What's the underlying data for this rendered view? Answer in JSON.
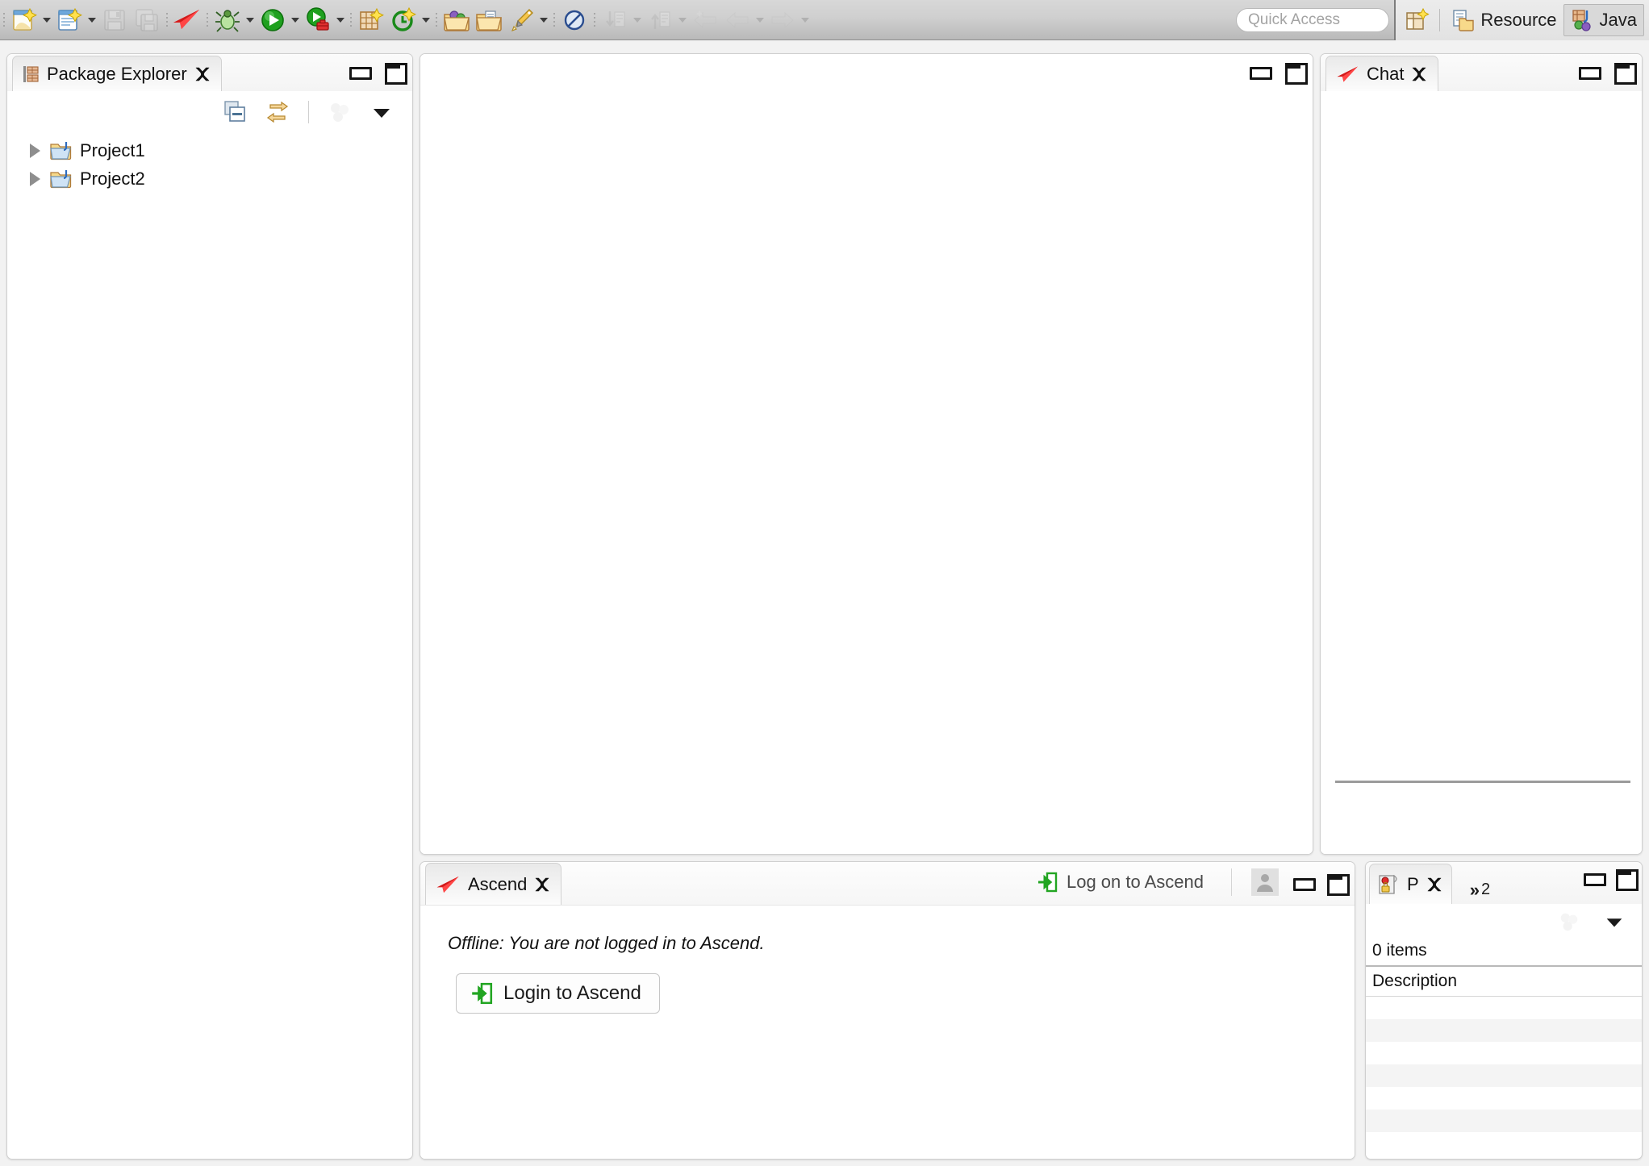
{
  "toolbar": {
    "groups": [
      {
        "name": "new-group",
        "buttons": [
          {
            "name": "new-wizard-button",
            "icon": "new-file-icon",
            "dropdown": true,
            "enabled": true
          },
          {
            "name": "new-java-class-button",
            "icon": "new-class-icon",
            "dropdown": true,
            "enabled": true
          },
          {
            "name": "save-button",
            "icon": "save-icon",
            "dropdown": false,
            "enabled": false
          },
          {
            "name": "save-all-button",
            "icon": "save-all-icon",
            "dropdown": false,
            "enabled": false
          }
        ]
      },
      {
        "name": "ascend-group",
        "buttons": [
          {
            "name": "ascend-button",
            "icon": "ascend-paper-plane-icon",
            "dropdown": false,
            "enabled": true
          }
        ]
      },
      {
        "name": "run-group",
        "buttons": [
          {
            "name": "debug-button",
            "icon": "debug-bug-icon",
            "dropdown": true,
            "enabled": true
          },
          {
            "name": "run-button",
            "icon": "run-play-icon",
            "dropdown": true,
            "enabled": true
          },
          {
            "name": "run-external-tools-button",
            "icon": "external-tools-icon",
            "dropdown": true,
            "enabled": true
          }
        ]
      },
      {
        "name": "java-group",
        "buttons": [
          {
            "name": "new-java-project-button",
            "icon": "new-java-project-icon",
            "dropdown": false,
            "enabled": true
          },
          {
            "name": "new-annotation-button",
            "icon": "new-annotation-icon",
            "dropdown": true,
            "enabled": true
          }
        ]
      },
      {
        "name": "open-group",
        "buttons": [
          {
            "name": "open-type-button",
            "icon": "open-type-icon",
            "dropdown": false,
            "enabled": true
          },
          {
            "name": "open-task-button",
            "icon": "open-task-icon",
            "dropdown": false,
            "enabled": true
          },
          {
            "name": "search-button",
            "icon": "pencil-search-icon",
            "dropdown": true,
            "enabled": true
          }
        ]
      },
      {
        "name": "marker-group",
        "buttons": [
          {
            "name": "skip-breakpoints-button",
            "icon": "skip-breakpoints-icon",
            "dropdown": false,
            "enabled": true
          }
        ]
      },
      {
        "name": "navigate-group",
        "buttons": [
          {
            "name": "next-annotation-button",
            "icon": "next-annotation-icon",
            "dropdown": true,
            "enabled": false
          },
          {
            "name": "previous-annotation-button",
            "icon": "previous-annotation-icon",
            "dropdown": true,
            "enabled": false
          },
          {
            "name": "last-edit-location-button",
            "icon": "last-edit-location-icon",
            "dropdown": false,
            "enabled": false
          },
          {
            "name": "back-button",
            "icon": "back-arrow-icon",
            "dropdown": true,
            "enabled": false
          },
          {
            "name": "forward-button",
            "icon": "forward-arrow-icon",
            "dropdown": true,
            "enabled": false
          }
        ]
      }
    ],
    "quick_access_placeholder": "Quick Access",
    "open_perspective_label": "",
    "perspectives": [
      {
        "name": "perspective-resource",
        "label": "Resource",
        "active": false
      },
      {
        "name": "perspective-java",
        "label": "Java",
        "active": true
      }
    ]
  },
  "package_explorer": {
    "tab_label": "Package Explorer",
    "toolbar": [
      {
        "name": "collapse-all-button",
        "icon": "collapse-all-icon",
        "enabled": true
      },
      {
        "name": "link-with-editor-button",
        "icon": "link-with-editor-icon",
        "enabled": true
      },
      {
        "name": "view-menu-filters-button",
        "icon": "filters-icon",
        "enabled": false
      },
      {
        "name": "view-menu-button",
        "icon": "view-menu-chevron-icon",
        "enabled": true
      }
    ],
    "tree": [
      {
        "label": "Project1",
        "expanded": false,
        "icon": "java-project-icon"
      },
      {
        "label": "Project2",
        "expanded": false,
        "icon": "java-project-icon"
      }
    ]
  },
  "editor": {
    "content": ""
  },
  "chat": {
    "tab_label": "Chat",
    "icon": "ascend-paper-plane-icon",
    "messages": [],
    "input_value": ""
  },
  "ascend": {
    "tab_label": "Ascend",
    "icon": "ascend-paper-plane-icon",
    "logon_link_label": "Log on to Ascend",
    "offline_message": "Offline: You are not logged in to Ascend.",
    "login_button_label": "Login to Ascend",
    "tools": [
      {
        "name": "user-account-button",
        "icon": "user-avatar-icon"
      }
    ]
  },
  "problems": {
    "tab_label": "P",
    "overflow_label": "2",
    "overflow_chevron": "»",
    "item_count_label": "0 items",
    "columns": [
      "Description"
    ],
    "rows": [],
    "placeholder_rows": 7,
    "toolbar": [
      {
        "name": "problems-filters-button",
        "icon": "filters-icon",
        "enabled": false
      },
      {
        "name": "problems-view-menu-button",
        "icon": "view-menu-chevron-icon",
        "enabled": true
      }
    ]
  },
  "window_controls": {
    "minimize_label": "Minimize",
    "maximize_label": "Maximize",
    "close_label": "Close"
  },
  "colors": {
    "toolbar_bg": "#cfcfcf",
    "panel_bg": "#ffffff",
    "accent_red": "#ee2a2a",
    "accent_green": "#2aa52a",
    "text": "#111111",
    "muted_text": "#a3a3a3",
    "divider": "#9b9b9b",
    "row_alt": "#f4f4f4"
  }
}
